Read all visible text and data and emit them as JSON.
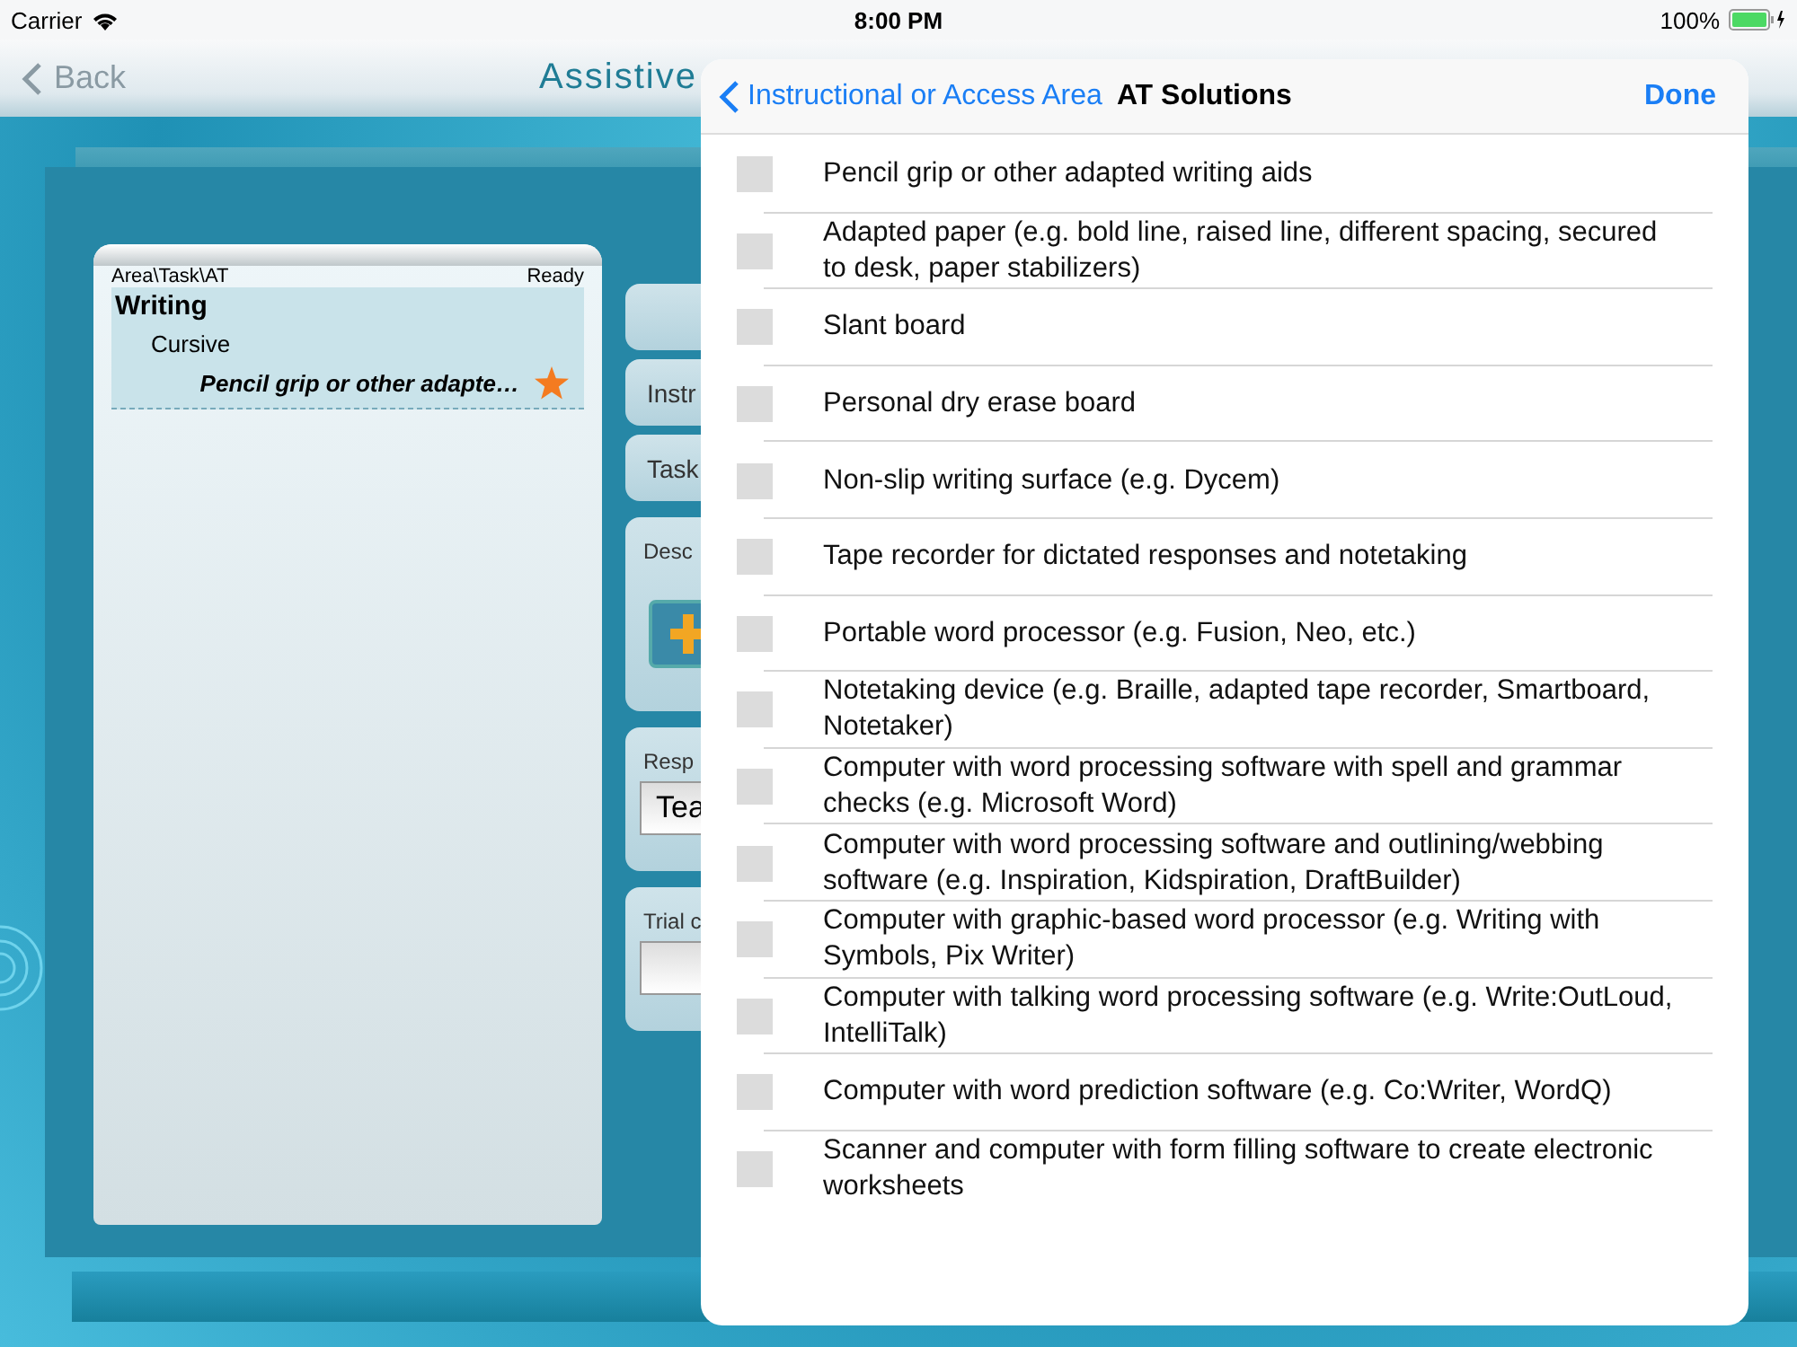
{
  "status_bar": {
    "carrier": "Carrier",
    "time": "8:00 PM",
    "battery": "100%"
  },
  "nav_bar": {
    "back": "Back",
    "title": "Assistive"
  },
  "tree": {
    "header": "Area\\Task\\AT",
    "status": "Ready",
    "items": [
      {
        "label": "Writing",
        "children": [
          {
            "label": "Cursive",
            "children": [
              {
                "label": "Pencil grip or other adapte…",
                "starred": true
              }
            ]
          }
        ]
      }
    ]
  },
  "side_fields": [
    {
      "kind": "blank"
    },
    {
      "kind": "label",
      "label": "Instr"
    },
    {
      "kind": "label",
      "label": "Task"
    },
    {
      "kind": "icon",
      "label": "Desc"
    },
    {
      "kind": "field",
      "label": "Resp",
      "value": "Tea"
    },
    {
      "kind": "field",
      "label": "Trial c"
    }
  ],
  "popover": {
    "back": "Instructional or Access Area",
    "title": "AT Solutions",
    "done": "Done",
    "options": [
      {
        "label": "Pencil grip or other adapted writing aids",
        "checked": false
      },
      {
        "label": "Adapted paper (e.g. bold line, raised line, different spacing, secured to desk, paper stabilizers)",
        "checked": false
      },
      {
        "label": "Slant board",
        "checked": false
      },
      {
        "label": "Personal dry erase board",
        "checked": false
      },
      {
        "label": "Non-slip writing surface (e.g. Dycem)",
        "checked": false
      },
      {
        "label": "Tape recorder for dictated responses and notetaking",
        "checked": false
      },
      {
        "label": "Portable word processor (e.g. Fusion, Neo, etc.)",
        "checked": false
      },
      {
        "label": "Notetaking device (e.g. Braille, adapted tape recorder, Smartboard, Notetaker)",
        "checked": false
      },
      {
        "label": "Computer with word processing software with spell and grammar checks (e.g. Microsoft Word)",
        "checked": false
      },
      {
        "label": "Computer with word processing software and outlining/webbing software (e.g. Inspiration, Kidspiration, DraftBuilder)",
        "checked": false
      },
      {
        "label": "Computer with graphic-based word processor (e.g. Writing with Symbols,  Pix Writer)",
        "checked": false
      },
      {
        "label": "Computer with talking word processing software (e.g. Write:OutLoud, IntelliTalk)",
        "checked": false
      },
      {
        "label": "Computer with word prediction software (e.g. Co:Writer, WordQ)",
        "checked": false
      },
      {
        "label": "Scanner and computer with form filling software to create electronic worksheets",
        "checked": false
      }
    ]
  }
}
